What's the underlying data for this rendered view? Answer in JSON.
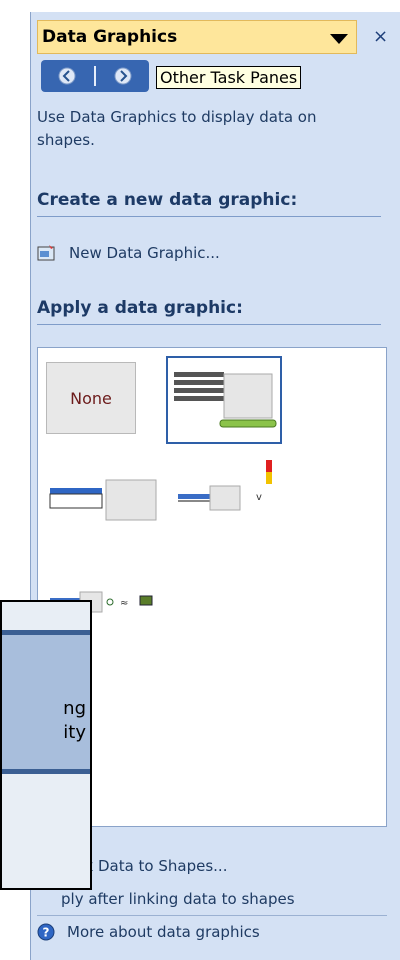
{
  "pane": {
    "title": "Data Graphics",
    "close_glyph": "×",
    "tooltip": "Other Task Panes",
    "description": "Use Data Graphics to display data on shapes.",
    "create_heading": "Create a new data graphic:",
    "new_graphic_link": "New Data Graphic...",
    "apply_heading": "Apply a data graphic:",
    "gallery": {
      "none_label": "None"
    },
    "link_data_fragment": "nk Data to Shapes...",
    "apply_after_fragment": "ply after linking data to shapes",
    "more_about_link": "More about data graphics"
  },
  "overlay_popup": {
    "line1": "ng",
    "line2": "ity"
  },
  "colors": {
    "pane_bg": "#d4e1f4",
    "title_bg": "#fee69b",
    "nav_bg": "#3766b1",
    "heading_text": "#1d3a66",
    "selected_border": "#2e5fa8"
  },
  "icons": [
    "dropdown-arrow-icon",
    "close-icon",
    "back-arrow-icon",
    "forward-arrow-icon",
    "new-data-graphic-icon",
    "help-icon"
  ]
}
